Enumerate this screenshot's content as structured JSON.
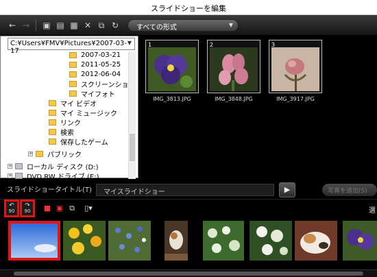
{
  "window": {
    "title": "スライドショーを編集"
  },
  "toolbar": {
    "format_filter": "すべての形式",
    "icons": [
      "back-arrow-icon",
      "forward-arrow-icon",
      "folder-up-icon",
      "new-folder-icon",
      "properties-icon",
      "delete-icon",
      "copy-icon",
      "refresh-icon"
    ]
  },
  "folder_panel": {
    "path": "C:¥Users¥FMV¥Pictures¥2007-03-17",
    "tree": [
      {
        "label": "2007-03-21",
        "indent": 3,
        "type": "folder"
      },
      {
        "label": "2011-05-25",
        "indent": 3,
        "type": "folder"
      },
      {
        "label": "2012-06-04",
        "indent": 3,
        "type": "folder"
      },
      {
        "label": "スクリーンショット",
        "indent": 3,
        "type": "folder"
      },
      {
        "label": "マイフォト",
        "indent": 3,
        "type": "folder"
      },
      {
        "label": "マイ ビデオ",
        "indent": 2,
        "type": "folder"
      },
      {
        "label": "マイ ミュージック",
        "indent": 2,
        "type": "folder"
      },
      {
        "label": "リンク",
        "indent": 2,
        "type": "folder"
      },
      {
        "label": "検索",
        "indent": 2,
        "type": "folder"
      },
      {
        "label": "保存したゲーム",
        "indent": 2,
        "type": "folder"
      },
      {
        "label": "パブリック",
        "indent": 1,
        "type": "folder"
      },
      {
        "label": "ローカル ディスク (D:)",
        "indent": 0,
        "type": "drive"
      },
      {
        "label": "DVD RW ドライブ (E:)",
        "indent": 0,
        "type": "drive"
      }
    ]
  },
  "photos": [
    {
      "number": "1",
      "name": "IMG_3813.JPG"
    },
    {
      "number": "2",
      "name": "IMG_3848.JPG"
    },
    {
      "number": "3",
      "name": "IMG_3917.JPG"
    }
  ],
  "slideshow": {
    "title_label": "スライドショータイトル(T)",
    "title_value": "マイスライドショー",
    "save_label": "写真を追加(S)"
  },
  "bottom_toolbar": {
    "rotate_left_degrees": "90",
    "rotate_right_degrees": "90",
    "right_label": "選"
  },
  "colors": {
    "highlight": "#e01515",
    "background": "#000000",
    "folder": "#f4c74a"
  }
}
